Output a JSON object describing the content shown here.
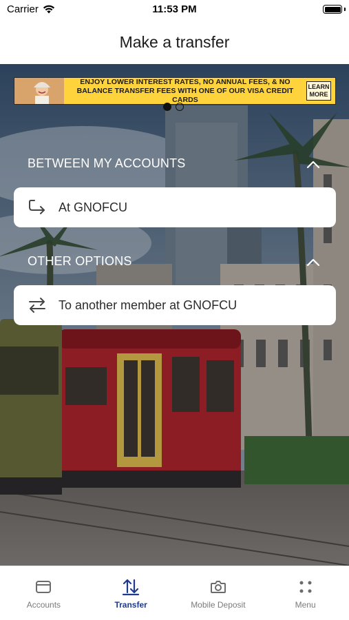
{
  "status_bar": {
    "carrier": "Carrier",
    "time": "11:53 PM"
  },
  "header": {
    "title": "Make a transfer"
  },
  "promo_banner": {
    "text": "ENJOY LOWER INTEREST RATES, NO ANNUAL FEES, & NO BALANCE TRANSFER FEES WITH ONE OF OUR VISA CREDIT CARDS",
    "cta_line1": "LEARN",
    "cta_line2": "MORE",
    "active_slide": 1,
    "slide_count": 2
  },
  "sections": [
    {
      "label": "BETWEEN MY ACCOUNTS",
      "options": [
        {
          "label": "At GNOFCU",
          "icon": "return-arrow-icon"
        }
      ]
    },
    {
      "label": "OTHER OPTIONS",
      "options": [
        {
          "label": "To another member at GNOFCU",
          "icon": "swap-arrows-icon"
        }
      ]
    }
  ],
  "tabbar": {
    "items": [
      {
        "label": "Accounts",
        "icon": "wallet-icon",
        "active": false
      },
      {
        "label": "Transfer",
        "icon": "transfer-arrows-icon",
        "active": true
      },
      {
        "label": "Mobile Deposit",
        "icon": "camera-icon",
        "active": false
      },
      {
        "label": "Menu",
        "icon": "grid-dots-icon",
        "active": false
      }
    ]
  },
  "colors": {
    "accent": "#1e3a8a",
    "promo_background": "#ffd33c",
    "inactive_tab": "#7a7a7a",
    "card_background": "#ffffff"
  }
}
